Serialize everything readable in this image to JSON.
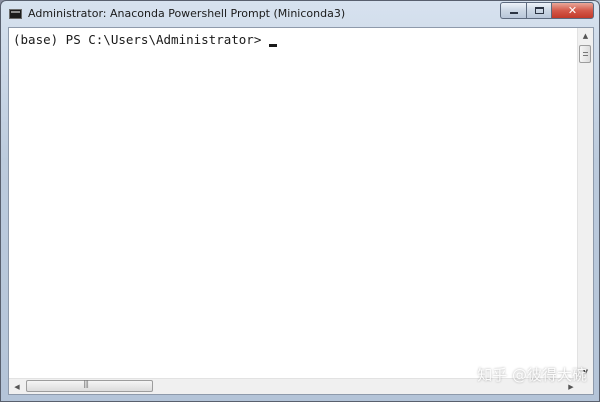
{
  "window": {
    "title": "Administrator: Anaconda Powershell Prompt (Miniconda3)",
    "icon": "console-icon"
  },
  "controls": {
    "minimize": "minimize-icon",
    "maximize": "maximize-icon",
    "close_label": "✕"
  },
  "console": {
    "prompt": "(base) PS C:\\Users\\Administrator>"
  },
  "watermark": {
    "text": "知乎 @彼得大碗"
  },
  "colors": {
    "console_background": "#ffffff",
    "console_text": "#1a1a1a",
    "close_button": "#c7402f"
  }
}
